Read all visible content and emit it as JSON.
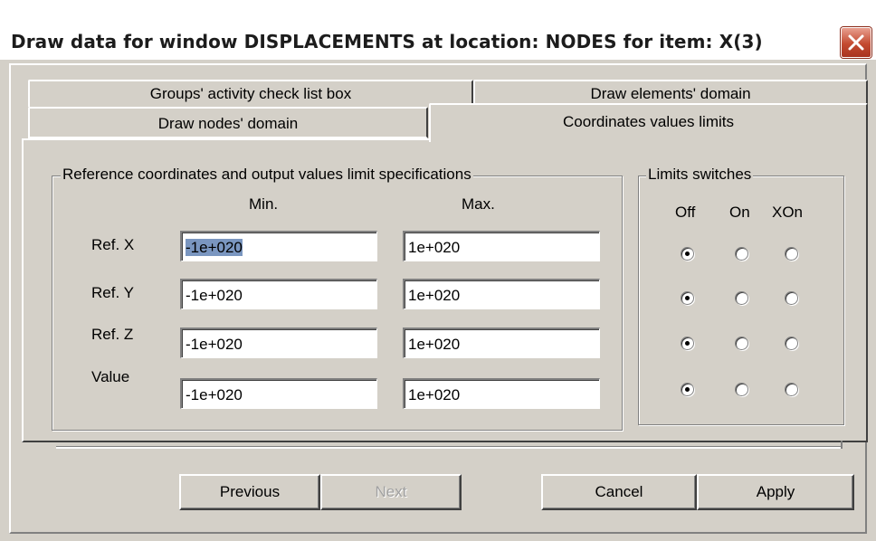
{
  "window": {
    "title": "Draw data for window DISPLACEMENTS at location: NODES for item: X(3)",
    "close_icon": "close-x-icon"
  },
  "tabs": {
    "row1": [
      {
        "label": "Groups' activity check list box"
      },
      {
        "label": "Draw elements' domain"
      }
    ],
    "row2": [
      {
        "label": "Draw nodes' domain"
      },
      {
        "label": "Coordinates values limits",
        "active": true
      }
    ]
  },
  "limits_group": {
    "legend": "Reference coordinates and output values limit specifications",
    "min_header": "Min.",
    "max_header": "Max.",
    "rows": [
      {
        "label": "Ref. X",
        "min": "-1e+020",
        "max": "1e+020"
      },
      {
        "label": "Ref. Y",
        "min": "-1e+020",
        "max": "1e+020"
      },
      {
        "label": "Ref. Z",
        "min": "-1e+020",
        "max": "1e+020"
      },
      {
        "label": "Value",
        "min": "-1e+020",
        "max": "1e+020"
      }
    ]
  },
  "switches_group": {
    "legend": "Limits switches",
    "headers": [
      "Off",
      "On",
      "XOn"
    ],
    "selected": [
      "Off",
      "Off",
      "Off",
      "Off"
    ]
  },
  "buttons": {
    "previous": "Previous",
    "next": "Next",
    "cancel": "Cancel",
    "apply": "Apply"
  },
  "colors": {
    "face": "#d4d0c8",
    "close_button": "#c44a30",
    "selection": "#7a96c0"
  }
}
